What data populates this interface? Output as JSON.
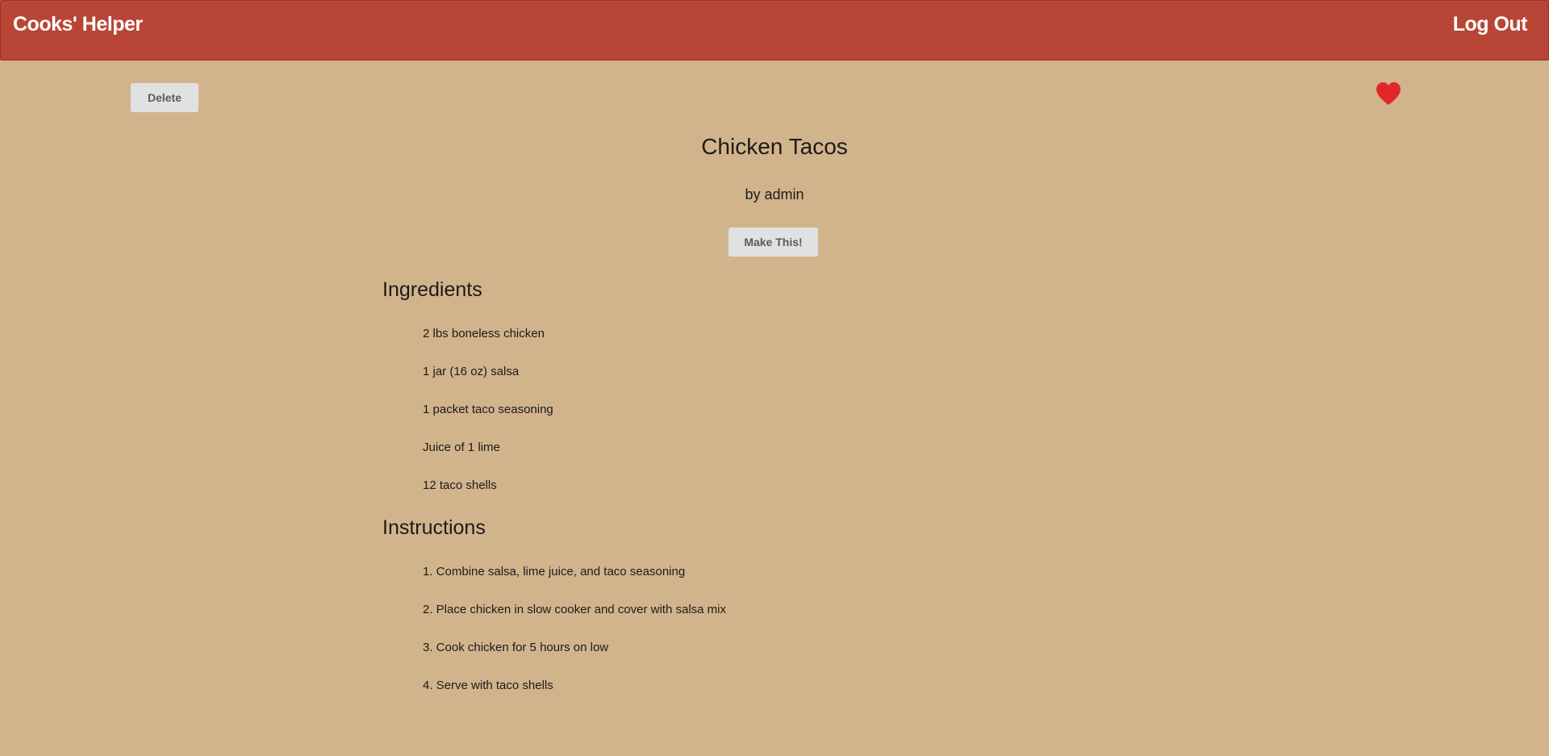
{
  "navbar": {
    "brand": "Cooks' Helper",
    "logout_label": "Log Out",
    "background_color": "#b84535"
  },
  "actions": {
    "delete_label": "Delete",
    "make_label": "Make This!",
    "favorite_icon": "heart-icon",
    "favorite_color": "#e02828"
  },
  "recipe": {
    "title": "Chicken Tacos",
    "author": "by admin",
    "ingredients_heading": "Ingredients",
    "ingredients": [
      "2 lbs boneless chicken",
      "1 jar (16 oz) salsa",
      "1 packet taco seasoning",
      "Juice of 1 lime",
      "12 taco shells"
    ],
    "instructions_heading": "Instructions",
    "instructions": [
      "1. Combine salsa, lime juice, and taco seasoning",
      "2. Place chicken in slow cooker and cover with salsa mix",
      "3. Cook chicken for 5 hours on low",
      "4. Serve with taco shells"
    ]
  },
  "page": {
    "background_color": "#d2b48c"
  }
}
